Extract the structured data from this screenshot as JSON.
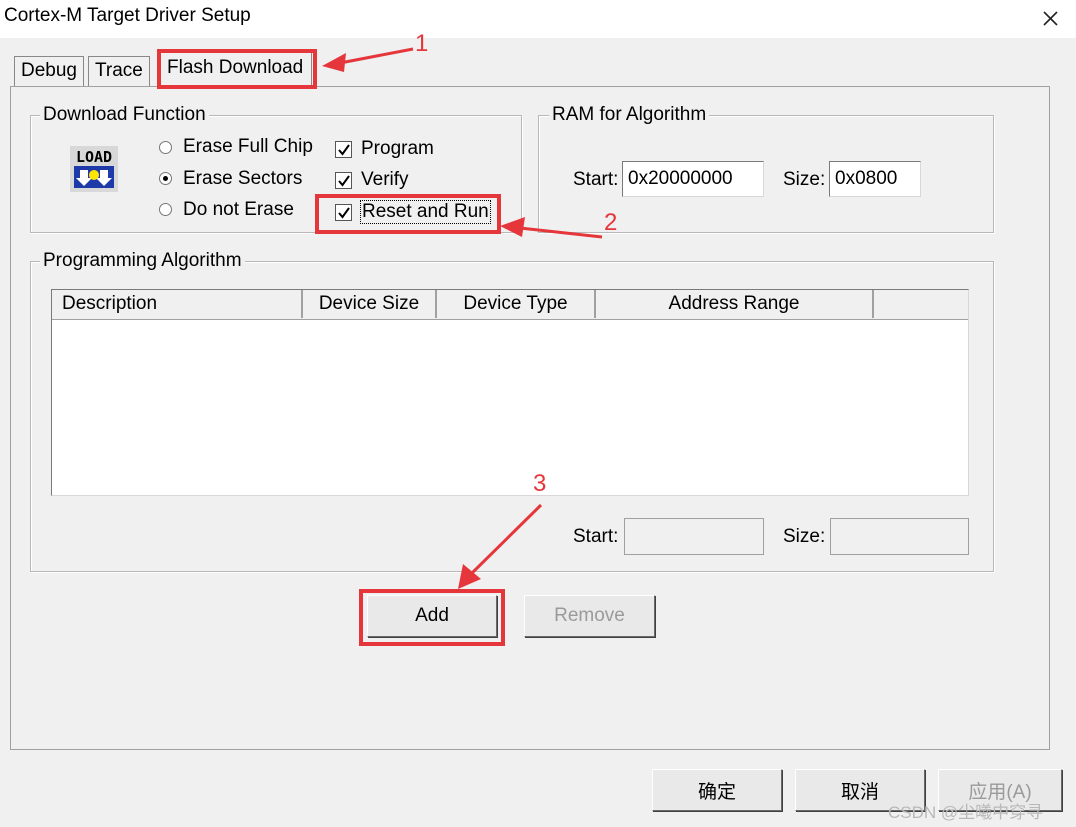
{
  "window": {
    "title": "Cortex-M Target Driver Setup"
  },
  "tabs": [
    {
      "label": "Debug"
    },
    {
      "label": "Trace"
    },
    {
      "label": "Flash Download"
    }
  ],
  "download_function": {
    "legend": "Download Function",
    "icon_text": "LOAD",
    "options": [
      {
        "label": "Erase Full Chip",
        "selected": false
      },
      {
        "label": "Erase Sectors",
        "selected": true
      },
      {
        "label": "Do not Erase",
        "selected": false
      }
    ],
    "checks": [
      {
        "label": "Program",
        "checked": true
      },
      {
        "label": "Verify",
        "checked": true
      },
      {
        "label": "Reset and Run",
        "checked": true
      }
    ]
  },
  "ram_for_algorithm": {
    "legend": "RAM for Algorithm",
    "start_label": "Start:",
    "start_value": "0x20000000",
    "size_label": "Size:",
    "size_value": "0x0800"
  },
  "programming_algorithm": {
    "legend": "Programming Algorithm",
    "columns": [
      "Description",
      "Device Size",
      "Device Type",
      "Address Range"
    ],
    "rows": [],
    "start_label": "Start:",
    "start_value": "",
    "size_label": "Size:",
    "size_value": ""
  },
  "buttons": {
    "add": "Add",
    "remove": "Remove",
    "ok": "确定",
    "cancel": "取消",
    "apply": "应用(A)"
  },
  "annotations": {
    "step1": "1",
    "step2": "2",
    "step3": "3",
    "highlight_color": "#e5363b"
  },
  "watermark": "CSDN @尘曦中穿寻"
}
